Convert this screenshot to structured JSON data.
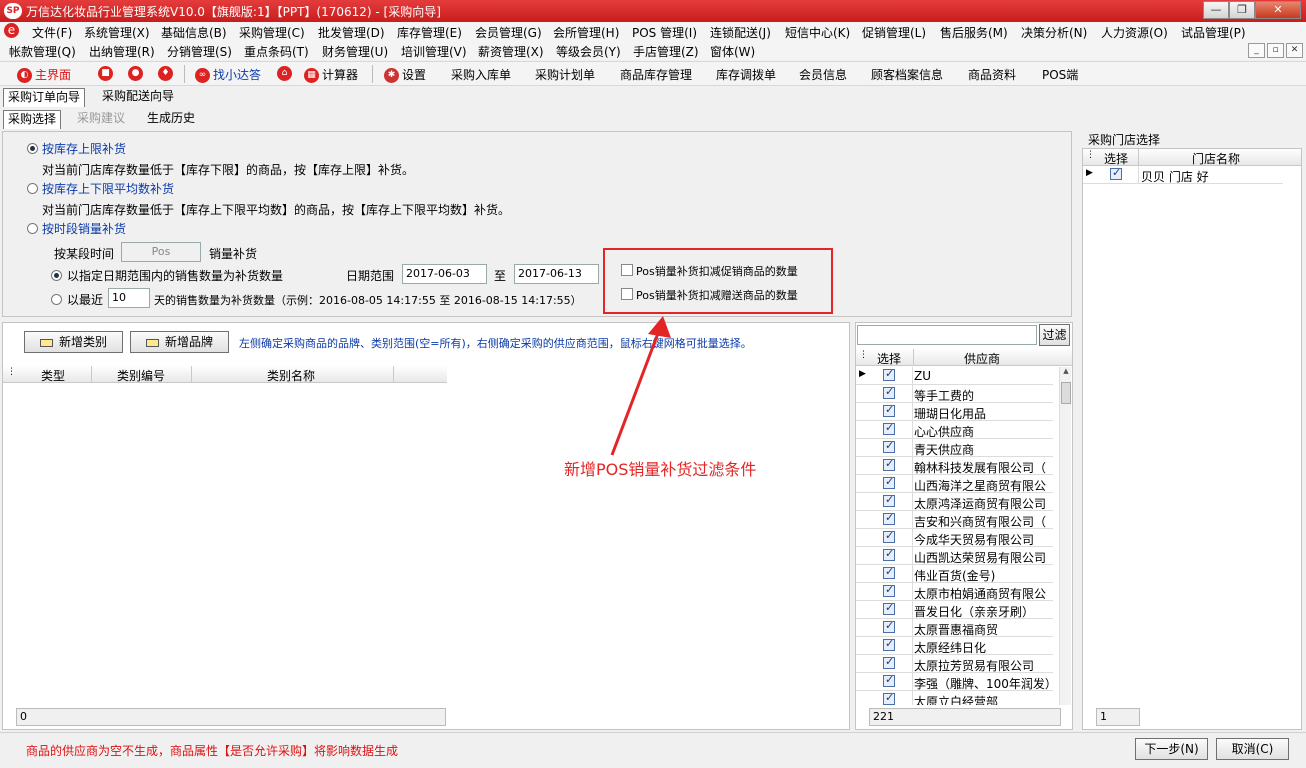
{
  "window": {
    "title": "万信达化妆品行业管理系统V10.0【旗舰版:1】【PPT】(170612) - [采购向导]",
    "logo_text": "SP"
  },
  "menu_row1": [
    "文件(F)",
    "系统管理(X)",
    "基础信息(B)",
    "采购管理(C)",
    "批发管理(D)",
    "库存管理(E)",
    "会员管理(G)",
    "会所管理(H)",
    "POS 管理(I)",
    "连锁配送(J)",
    "短信中心(K)",
    "促销管理(L)",
    "售后服务(M)",
    "决策分析(N)",
    "人力资源(O)",
    "试品管理(P)"
  ],
  "menu_row2": [
    "帐款管理(Q)",
    "出纳管理(R)",
    "分销管理(S)",
    "重点条码(T)",
    "财务管理(U)",
    "培训管理(V)",
    "薪资管理(X)",
    "等级会员(Y)",
    "手店管理(Z)",
    "窗体(W)"
  ],
  "toolbar": {
    "home": "主界面",
    "find": "找小达答",
    "calculator": "计算器",
    "settings": "设置",
    "items": [
      "采购入库单",
      "采购计划单",
      "商品库存管理",
      "库存调拨单",
      "会员信息",
      "顾客档案信息",
      "商品资料",
      "POS端"
    ]
  },
  "tabs_top": [
    "采购订单向导",
    "采购配送向导"
  ],
  "tabs_sub": [
    "采购选择",
    "采购建议",
    "生成历史"
  ],
  "options": {
    "opt1_label": "按库存上限补货",
    "opt1_desc": "对当前门店库存数量低于【库存下限】的商品，按【库存上限】补货。",
    "opt2_label": "按库存上下限平均数补货",
    "opt2_desc": "对当前门店库存数量低于【库存上下限平均数】的商品，按【库存上下限平均数】补货。",
    "opt3_label": "按时段销量补货",
    "period_label": "按某段时间",
    "period_source": "Pos",
    "period_suffix": "销量补货",
    "range_radio_label": "以指定日期范围内的销售数量为补货数量",
    "date_range_label": "日期范围",
    "date_from": "2017-06-03",
    "date_to_label": "至",
    "date_to": "2017-06-13",
    "recent_prefix": "以最近",
    "recent_days": "10",
    "recent_suffix": "天的销售数量为补货数量（示例：2016-08-05 14:17:55 至 2016-08-15 14:17:55）",
    "pos_promo_check": "Pos销量补货扣减促销商品的数量",
    "pos_gift_check": "Pos销量补货扣减赠送商品的数量"
  },
  "annotation": "新增POS销量补货过滤条件",
  "left_list": {
    "add_category_btn": "新增类别",
    "add_brand_btn": "新增品牌",
    "hint": "左侧确定采购商品的品牌、类别范围(空=所有)，右侧确定采购的供应商范围，鼠标右键网格可批量选择。",
    "columns": [
      "类型",
      "类别编号",
      "类别名称"
    ],
    "footer_count": "0"
  },
  "suppliers": {
    "filter_btn": "过滤",
    "columns": [
      "选择",
      "供应商"
    ],
    "rows": [
      "ZU",
      "等手工费的",
      "珊瑚日化用品",
      "心心供应商",
      "青天供应商",
      "翰林科技发展有限公司（",
      "山西海洋之星商贸有限公",
      "太原鸿泽运商贸有限公司",
      "吉安和兴商贸有限公司（",
      "今成华天贸易有限公司",
      "山西凯达荣贸易有限公司",
      "伟业百货(金号)",
      "太原市柏娟通商贸有限公",
      "晋发日化（亲亲牙刷）",
      "太原晋惠福商贸",
      "太原经纬日化",
      "太原拉芳贸易有限公司",
      "李强（雕牌、100年润发）",
      "太原立白经营部"
    ],
    "footer_count": "221"
  },
  "stores": {
    "title": "采购门店选择",
    "columns": [
      "选择",
      "门店名称"
    ],
    "rows": [
      "贝贝 门店 好"
    ],
    "footer_count": "1"
  },
  "status": {
    "message": "商品的供应商为空不生成，商品属性【是否允许采购】将影响数据生成",
    "next_btn": "下一步(N)",
    "cancel_btn": "取消(C)"
  },
  "colors": {
    "title_red": "#d22a2a",
    "annotation_red": "#e42525",
    "link_blue": "#0a3aa8"
  }
}
